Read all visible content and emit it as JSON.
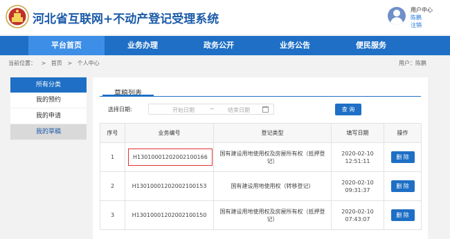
{
  "header": {
    "title": "河北省互联网+不动产登记受理系统",
    "user_center": "用户中心",
    "user_name": "陈鹏",
    "logout": "注销"
  },
  "nav": {
    "items": [
      {
        "label": "平台首页"
      },
      {
        "label": "业务办理"
      },
      {
        "label": "政务公开"
      },
      {
        "label": "业务公告"
      },
      {
        "label": "便民服务"
      }
    ]
  },
  "breadcrumb": {
    "prefix": "当前位置：",
    "sep": ">",
    "home": "首页",
    "current": "个人中心",
    "user_label": "用户：陈鹏"
  },
  "sidebar": {
    "head": "所有分类",
    "items": [
      {
        "label": "我的预约"
      },
      {
        "label": "我的申请"
      },
      {
        "label": "我的草稿"
      }
    ]
  },
  "panel": {
    "tab": "草稿列表",
    "date_label": "选择日期:",
    "date_start_placeholder": "开始日期",
    "date_sep": "~",
    "date_end_placeholder": "结束日期",
    "query_button": "查 询"
  },
  "table": {
    "headers": [
      "序号",
      "业务编号",
      "登记类型",
      "填写日期",
      "操作"
    ],
    "rows": [
      {
        "index": "1",
        "code": "H13010001202002100166",
        "type": "国有建设用地使用权及房屋所有权（抵押登记）",
        "date": "2020-02-10",
        "time": "12:51:11",
        "action": "删 除"
      },
      {
        "index": "2",
        "code": "H13010001202002100153",
        "type": "国有建设用地使用权（转移登记）",
        "date": "2020-02-10",
        "time": "09:31:37",
        "action": "删 除"
      },
      {
        "index": "3",
        "code": "H13010001202002100150",
        "type": "国有建设用地使用权及房屋所有权（抵押登记）",
        "date": "2020-02-10",
        "time": "07:43:07",
        "action": "删 除"
      }
    ]
  }
}
